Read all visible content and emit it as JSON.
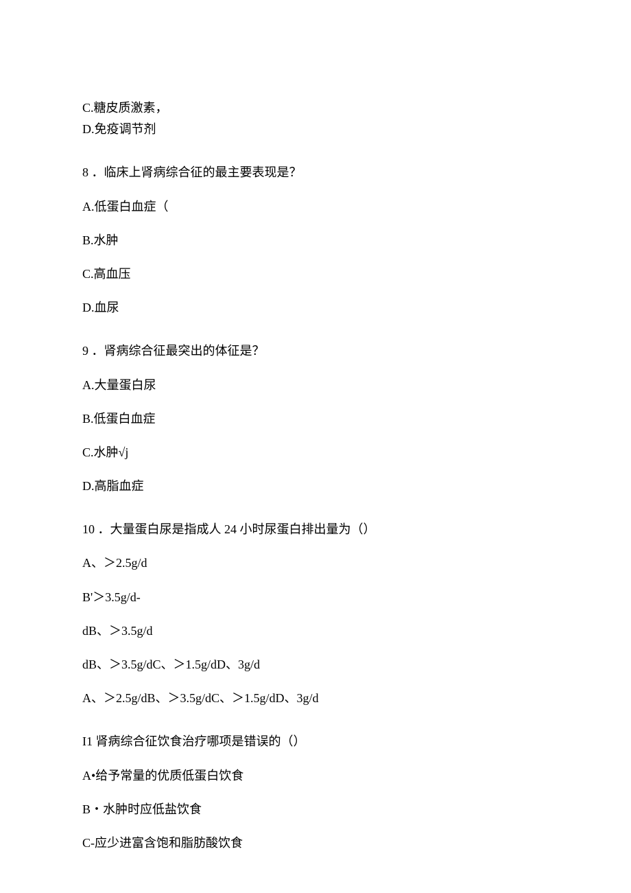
{
  "q7_options": {
    "c": "C.糖皮质激素，",
    "d": "D.免疫调节剂"
  },
  "q8": {
    "stem": "8 ．临床上肾病综合征的最主要表现是？",
    "a": "A.低蛋白血症（",
    "b": "B.水肿",
    "c": "C.高血压",
    "d": "D.血尿"
  },
  "q9": {
    "stem": "9 ．肾病综合征最突出的体征是？",
    "a": "A.大量蛋白尿",
    "b": "B.低蛋白血症",
    "c": "C.水肿√j",
    "d": "D.高脂血症"
  },
  "q10": {
    "stem": "10 ．大量蛋白尿是指成人 24 小时尿蛋白排出量为（）",
    "a": "A、＞2.5g/d",
    "b": "B'＞3.5g/d-",
    "c": "dB、＞3.5g/d",
    "d": "dB、＞3.5g/dC、＞1.5g/dD、3g/d",
    "e": "A、＞2.5g/dB、＞3.5g/dC、＞1.5g/dD、3g/d"
  },
  "q11": {
    "stem": "I1 肾病综合征饮食治疗哪项是错误的（）",
    "a": "A•给予常量的优质低蛋白饮食",
    "b": "B・水肿时应低盐饮食",
    "c": "C-应少进富含饱和脂肪酸饮食"
  }
}
